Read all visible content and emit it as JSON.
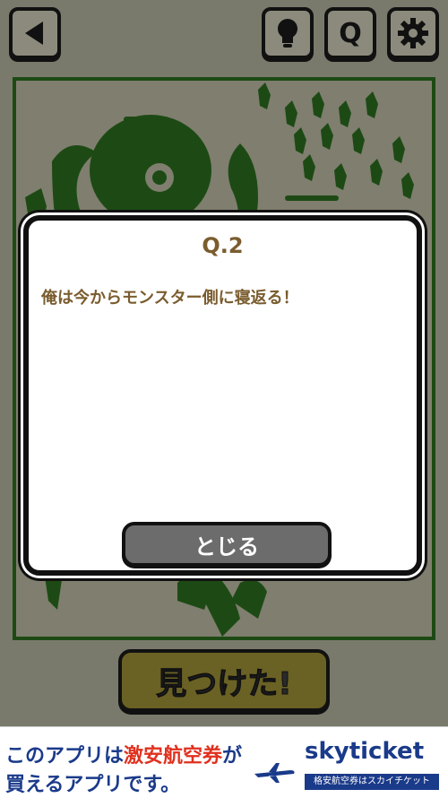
{
  "toolbar": {
    "back_icon": "back-triangle-icon",
    "hint_icon": "lightbulb-icon",
    "question_label": "Q",
    "settings_icon": "gear-icon"
  },
  "modal": {
    "title": "Q.2",
    "text": "俺は今からモンスター側に寝返る！",
    "close_label": "とじる"
  },
  "found_button": {
    "label": "見つけた!"
  },
  "ad": {
    "line1_a": "このアプリは",
    "line1_highlight": "激安航空券",
    "line1_b": "が",
    "line2": "買えるアプリです。",
    "brand": "skyticket",
    "tagline": "格安航空券はスカイチケット"
  },
  "colors": {
    "scene_green": "#1d4a14",
    "modal_text": "#7a5c2e",
    "found_button": "#6a6124",
    "ad_blue": "#1a3a8a",
    "ad_red": "#e0301e"
  }
}
